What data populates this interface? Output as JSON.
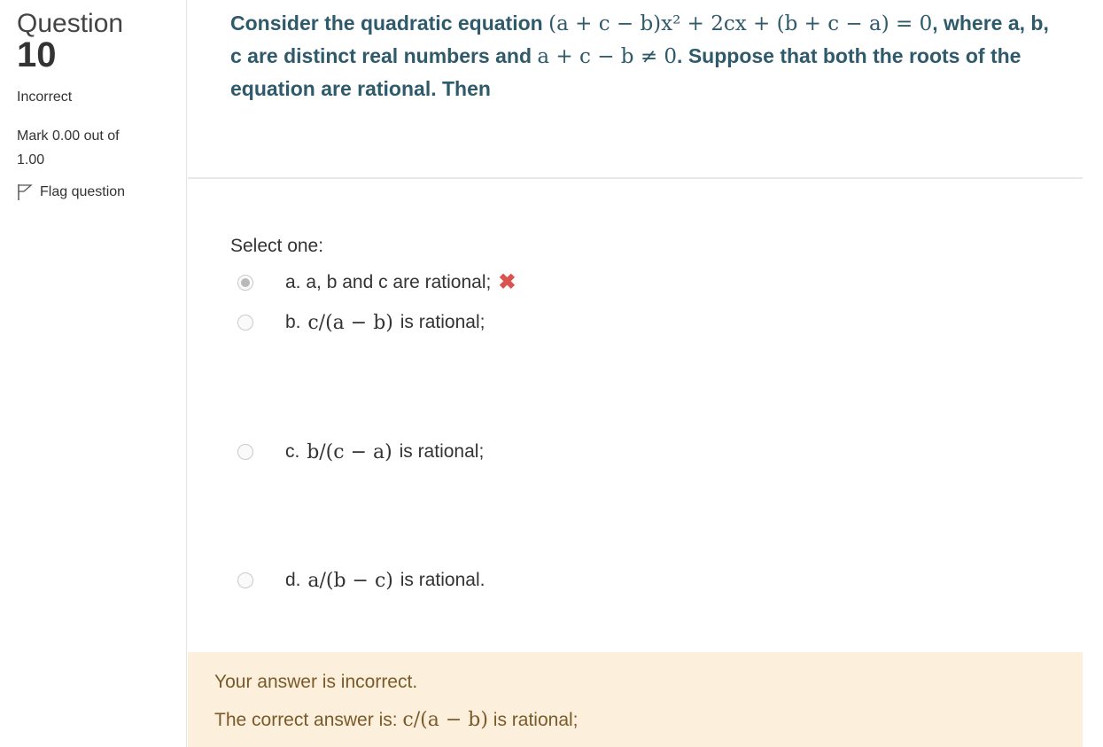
{
  "info": {
    "question_word": "Question",
    "question_number": "10",
    "state": "Incorrect",
    "grade": "Mark 0.00 out of 1.00",
    "flag_label": "Flag question"
  },
  "question": {
    "lead": "Consider the quadratic equation",
    "equation": "(a + c − b)x² + 2cx + (b + c − a) = 0",
    "mid": ", where a, b, c are distinct real numbers and",
    "condition": "a + c − b ≠ 0",
    "tail": ". Suppose that both the roots of the equation are rational. Then"
  },
  "prompt": "Select one:",
  "options": [
    {
      "letter": "a.",
      "math": "",
      "text": "a, b and c are rational;",
      "selected": true,
      "mark": "✖"
    },
    {
      "letter": "b.",
      "math": "c/(a − b)",
      "text": "is rational;",
      "selected": false
    },
    {
      "letter": "c.",
      "math": "b/(c − a)",
      "text": "is rational;",
      "selected": false
    },
    {
      "letter": "d.",
      "math": "a/(b − c)",
      "text": "is rational.",
      "selected": false
    }
  ],
  "feedback": {
    "status": "Your answer is incorrect.",
    "prefix": "The correct answer is:",
    "math": "c/(a − b)",
    "suffix": "is rational;"
  },
  "colors": {
    "question_text": "#2f5a6b",
    "feedback_bg": "#fcefdc",
    "feedback_text": "#7a5a2a",
    "incorrect_mark": "#d9534f"
  }
}
